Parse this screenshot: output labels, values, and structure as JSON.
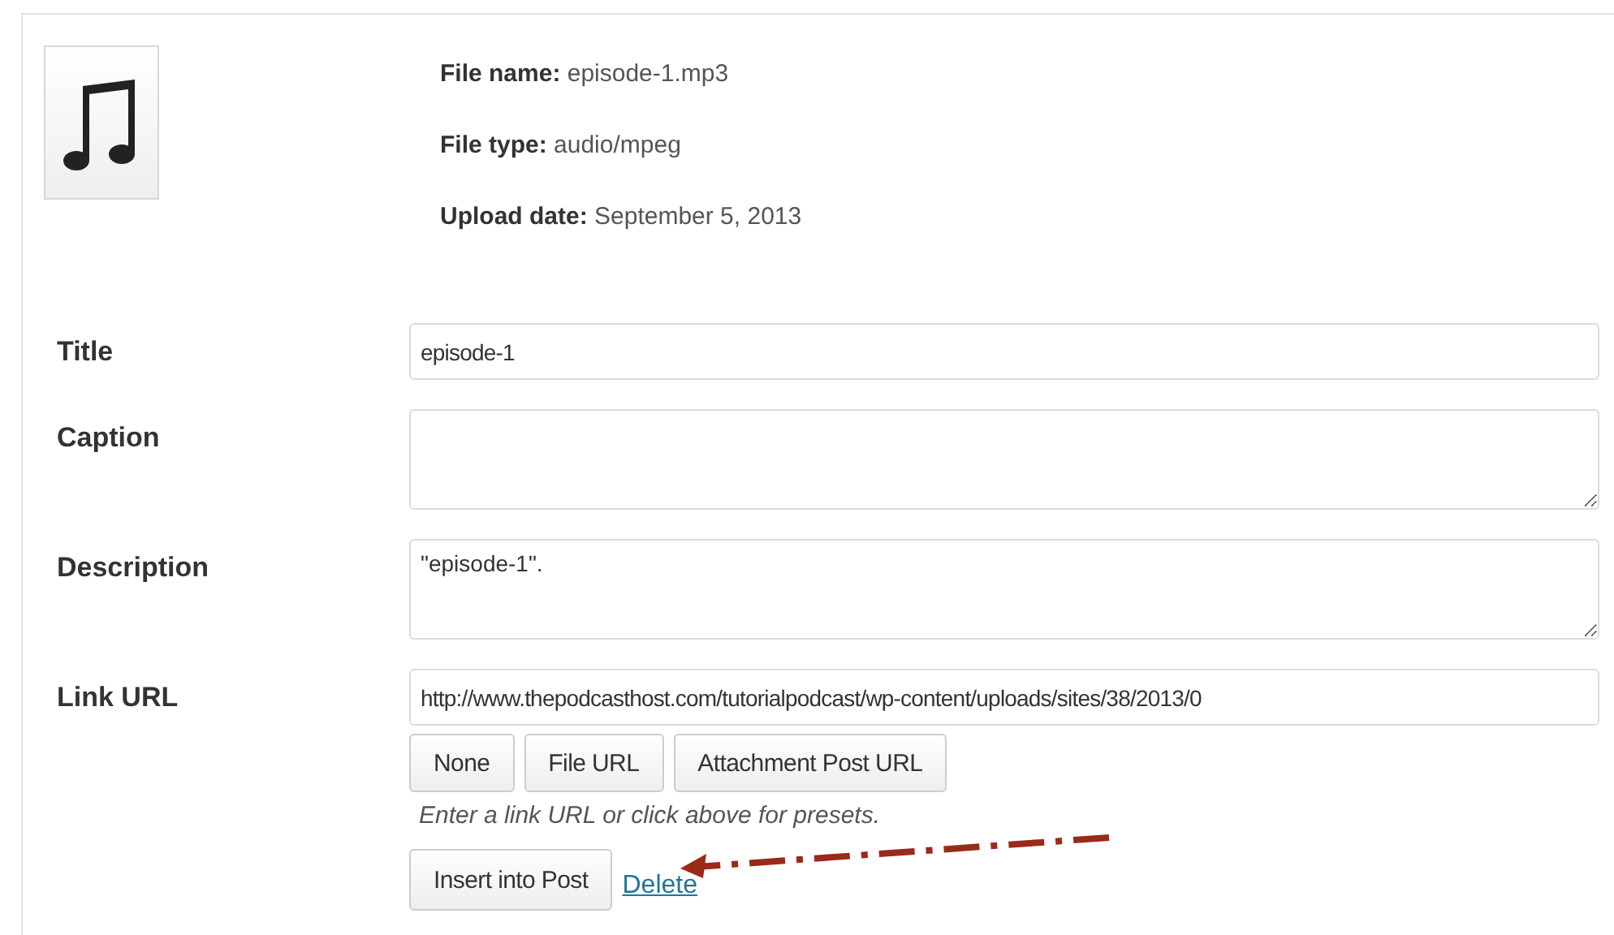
{
  "file_info": [
    {
      "label": "File name:",
      "value": "episode-1.mp3"
    },
    {
      "label": "File type:",
      "value": "audio/mpeg"
    },
    {
      "label": "Upload date:",
      "value": "September 5, 2013"
    }
  ],
  "fields": [
    {
      "label": "Title",
      "kind": "input",
      "value": "episode-1"
    },
    {
      "label": "Caption",
      "kind": "textarea"
    },
    {
      "label": "Description",
      "kind": "textarea",
      "value": "\"episode-1\"."
    },
    {
      "label": "Link URL",
      "kind": "input",
      "value": "http://www.thepodcasthost.com/tutorialpodcast/wp-content/uploads/sites/38/2013/0"
    }
  ],
  "link_buttons": [
    "None",
    "File URL",
    "Attachment Post URL"
  ],
  "hint": "Enter a link URL or click above for presets.",
  "insert_button": "Insert into Post",
  "delete_link": "Delete"
}
